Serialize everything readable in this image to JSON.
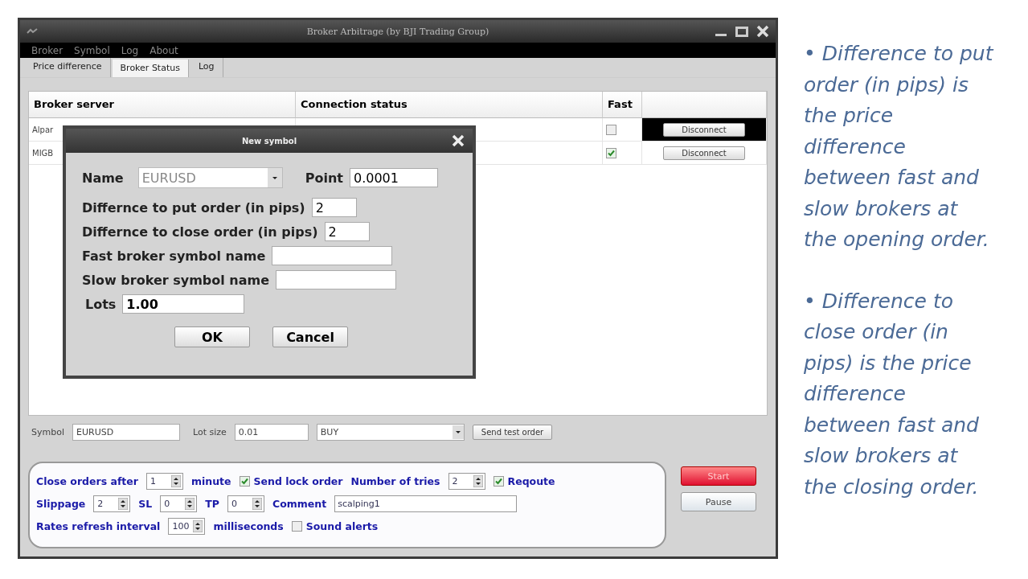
{
  "window": {
    "title": "Broker Arbitrage (by BJI Trading Group)"
  },
  "menu": [
    "Broker",
    "Symbol",
    "Log",
    "About"
  ],
  "tabs": [
    {
      "label": "Price difference",
      "selected": false
    },
    {
      "label": "Broker Status",
      "selected": true
    },
    {
      "label": "Log",
      "selected": false
    }
  ],
  "table": {
    "columns": [
      "Broker server",
      "Connection status",
      "Fast"
    ],
    "rows": [
      {
        "server": "Alpar",
        "fast": false,
        "selected": true,
        "button": "Disconnect"
      },
      {
        "server": "MIGB",
        "fast": true,
        "selected": false,
        "button": "Disconnect"
      }
    ]
  },
  "dialog": {
    "title": "New symbol",
    "name_label": "Name",
    "name_value": "EURUSD",
    "point_label": "Point",
    "point_value": "0.0001",
    "fields": [
      {
        "label": "Differnce to put order (in pips)",
        "value": "2",
        "kind": "short"
      },
      {
        "label": "Differnce to close order (in pips)",
        "value": "2",
        "kind": "short"
      },
      {
        "label": "Fast broker symbol name",
        "kind": "long"
      },
      {
        "label": "Slow broker symbol name",
        "kind": "long"
      }
    ],
    "lots_label": "Lots",
    "lots_value": "1.00",
    "buttons": [
      "OK",
      "Cancel"
    ]
  },
  "order_bar": {
    "symbol_label": "Symbol",
    "symbol_value": "EURUSD",
    "lot_label": "Lot size",
    "lot_value": "0.01",
    "side": "BUY",
    "button": "Send test order"
  },
  "settings": {
    "rows": [
      {
        "items": [
          {
            "kind": "label",
            "text": "Close orders after"
          },
          {
            "kind": "spinner",
            "value": "1"
          },
          {
            "kind": "label",
            "text": "minute"
          },
          {
            "kind": "checkbox",
            "text": "Send lock order",
            "checked": true
          },
          {
            "kind": "label",
            "text": "Number of tries"
          },
          {
            "kind": "spinner",
            "value": "2"
          },
          {
            "kind": "checkbox",
            "text": "Reqoute",
            "checked": true
          }
        ]
      },
      {
        "items": [
          {
            "kind": "label",
            "text": "Slippage"
          },
          {
            "kind": "spinner",
            "value": "2"
          },
          {
            "kind": "label",
            "text": "SL"
          },
          {
            "kind": "spinner",
            "value": "0"
          },
          {
            "kind": "label",
            "text": "TP"
          },
          {
            "kind": "spinner",
            "value": "0"
          },
          {
            "kind": "label",
            "text": "Comment"
          },
          {
            "kind": "field",
            "value": "scalping1"
          }
        ]
      },
      {
        "items": [
          {
            "kind": "label",
            "text": "Rates refresh interval"
          },
          {
            "kind": "spinner",
            "value": "100"
          },
          {
            "kind": "label",
            "text": "milliseconds"
          },
          {
            "kind": "checkbox",
            "text": "Sound alerts",
            "checked": false
          }
        ]
      }
    ]
  },
  "actions": [
    {
      "label": "Start",
      "kind": "primary"
    },
    {
      "label": "Pause",
      "kind": "normal"
    }
  ],
  "notes": [
    "• Difference to put order (in pips) is the price difference between fast and slow brokers at the opening order.",
    "• Difference to close order (in pips) is the price difference between fast and slow brokers at the closing order."
  ]
}
